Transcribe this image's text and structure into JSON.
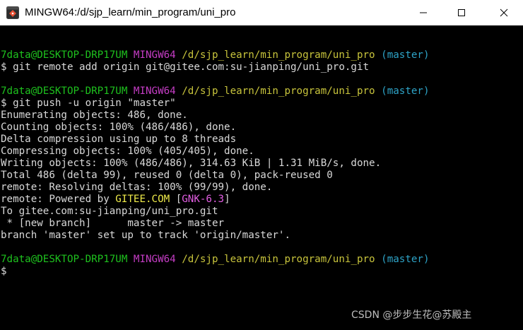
{
  "window": {
    "title": "MINGW64:/d/sjp_learn/min_program/uni_pro",
    "app_icon": "git-bash-icon",
    "controls": [
      "minimize-icon",
      "maximize-icon",
      "close-icon"
    ]
  },
  "terminal": {
    "lines": [
      [],
      [
        {
          "t": "7data@DESKTOP-DRP17UM",
          "c": "green"
        },
        {
          "t": " ",
          "c": "white"
        },
        {
          "t": "MINGW64",
          "c": "magenta"
        },
        {
          "t": " ",
          "c": "white"
        },
        {
          "t": "/d/sjp_learn/min_program/uni_pro",
          "c": "yellow"
        },
        {
          "t": " ",
          "c": "white"
        },
        {
          "t": "(master)",
          "c": "cyan"
        }
      ],
      [
        {
          "t": "$ git remote add origin git@gitee.com:su-jianping/uni_pro.git",
          "c": "white"
        }
      ],
      [],
      [
        {
          "t": "7data@DESKTOP-DRP17UM",
          "c": "green"
        },
        {
          "t": " ",
          "c": "white"
        },
        {
          "t": "MINGW64",
          "c": "magenta"
        },
        {
          "t": " ",
          "c": "white"
        },
        {
          "t": "/d/sjp_learn/min_program/uni_pro",
          "c": "yellow"
        },
        {
          "t": " ",
          "c": "white"
        },
        {
          "t": "(master)",
          "c": "cyan"
        }
      ],
      [
        {
          "t": "$ git push -u origin \"master\"",
          "c": "white"
        }
      ],
      [
        {
          "t": "Enumerating objects: 486, done.",
          "c": "white"
        }
      ],
      [
        {
          "t": "Counting objects: 100% (486/486), done.",
          "c": "white"
        }
      ],
      [
        {
          "t": "Delta compression using up to 8 threads",
          "c": "white"
        }
      ],
      [
        {
          "t": "Compressing objects: 100% (405/405), done.",
          "c": "white"
        }
      ],
      [
        {
          "t": "Writing objects: 100% (486/486), 314.63 KiB | 1.31 MiB/s, done.",
          "c": "white"
        }
      ],
      [
        {
          "t": "Total 486 (delta 99), reused 0 (delta 0), pack-reused 0",
          "c": "white"
        }
      ],
      [
        {
          "t": "remote: Resolving deltas: 100% (99/99), done.",
          "c": "white"
        }
      ],
      [
        {
          "t": "remote: Powered by ",
          "c": "white"
        },
        {
          "t": "GITEE.COM",
          "c": "bright-yellow"
        },
        {
          "t": " [",
          "c": "white"
        },
        {
          "t": "GNK-6.3",
          "c": "pink"
        },
        {
          "t": "]",
          "c": "white"
        }
      ],
      [
        {
          "t": "To gitee.com:su-jianping/uni_pro.git",
          "c": "white"
        }
      ],
      [
        {
          "t": " * [new branch]      master -> master",
          "c": "white"
        }
      ],
      [
        {
          "t": "branch 'master' set up to track 'origin/master'.",
          "c": "white"
        }
      ],
      [],
      [
        {
          "t": "7data@DESKTOP-DRP17UM",
          "c": "green"
        },
        {
          "t": " ",
          "c": "white"
        },
        {
          "t": "MINGW64",
          "c": "magenta"
        },
        {
          "t": " ",
          "c": "white"
        },
        {
          "t": "/d/sjp_learn/min_program/uni_pro",
          "c": "yellow"
        },
        {
          "t": " ",
          "c": "white"
        },
        {
          "t": "(master)",
          "c": "cyan"
        }
      ],
      [
        {
          "t": "$",
          "c": "white"
        }
      ]
    ]
  },
  "watermark": "CSDN @步步生花@苏殿主",
  "colors": {
    "background": "#000000",
    "green": "#1ec21e",
    "magenta": "#c53dc5",
    "yellow": "#c8c43c",
    "cyan": "#2ea4c8",
    "white": "#d9d9d9",
    "bright-yellow": "#f0ec4a",
    "pink": "#e35ee3"
  }
}
